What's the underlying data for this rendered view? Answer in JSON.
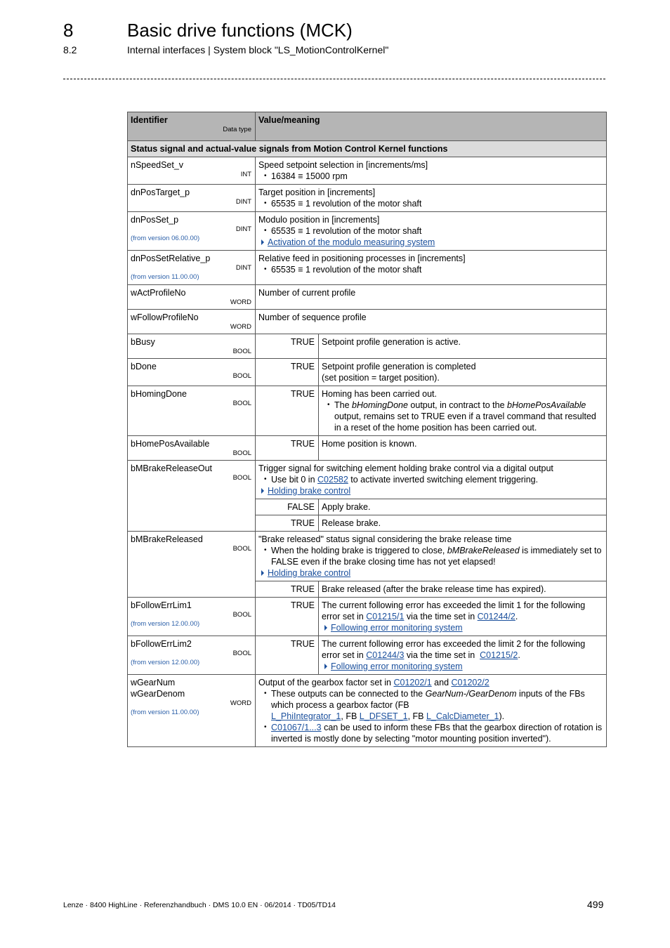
{
  "header": {
    "chapter_number": "8",
    "chapter_title": "Basic drive functions (MCK)",
    "section_number": "8.2",
    "section_title": "Internal interfaces | System block \"LS_MotionControlKernel\""
  },
  "table": {
    "col_identifier": "Identifier",
    "col_datatype": "Data type",
    "col_value": "Value/meaning",
    "group_title": "Status signal and actual-value signals from Motion Control Kernel functions",
    "rows": {
      "nSpeedSet_v": {
        "name": "nSpeedSet_v",
        "type": "INT",
        "desc": "Speed setpoint selection in [increments/ms]",
        "bullet": "16384 ≡ 15000 rpm"
      },
      "dnPosTarget_p": {
        "name": "dnPosTarget_p",
        "type": "DINT",
        "desc": "Target position in [increments]",
        "bullet": "65535 ≡ 1 revolution of the motor shaft"
      },
      "dnPosSet_p": {
        "name": "dnPosSet_p",
        "type": "DINT",
        "version": "(from version 06.00.00)",
        "desc": "Modulo position in [increments]",
        "bullet": "65535 ≡ 1 revolution of the motor shaft",
        "link": "Activation of the modulo measuring system"
      },
      "dnPosSetRelative_p": {
        "name": "dnPosSetRelative_p",
        "type": "DINT",
        "version": "(from version 11.00.00)",
        "desc": "Relative feed in positioning processes in [increments]",
        "bullet": "65535 ≡ 1 revolution of the motor shaft"
      },
      "wActProfileNo": {
        "name": "wActProfileNo",
        "type": "WORD",
        "desc": "Number of current profile"
      },
      "wFollowProfileNo": {
        "name": "wFollowProfileNo",
        "type": "WORD",
        "desc": "Number of sequence profile"
      },
      "bBusy": {
        "name": "bBusy",
        "type": "BOOL",
        "value": "TRUE",
        "desc": "Setpoint profile generation is active."
      },
      "bDone": {
        "name": "bDone",
        "type": "BOOL",
        "value": "TRUE",
        "desc": "Setpoint profile generation is completed",
        "desc2": "(set position = target position)."
      },
      "bHomingDone": {
        "name": "bHomingDone",
        "type": "BOOL",
        "value": "TRUE",
        "desc": "Homing has been carried out.",
        "bullet_pre": "The ",
        "bullet_em1": "bHomingDone",
        "bullet_mid": " output, in contract to the ",
        "bullet_em2": "bHomePosAvailable",
        "bullet_post": " output, remains set to TRUE even if a travel command that resulted in a reset of the home position has been carried out."
      },
      "bHomePosAvailable": {
        "name": "bHomePosAvailable",
        "type": "BOOL",
        "value": "TRUE",
        "desc": "Home position is known."
      },
      "bMBrakeReleaseOut": {
        "name": "bMBrakeReleaseOut",
        "type": "BOOL",
        "desc": "Trigger signal for switching element holding brake control via a digital output",
        "bullet_pre": "Use bit 0 in ",
        "bullet_link": "C02582",
        "bullet_post": " to activate inverted switching element triggering.",
        "link": "Holding brake control",
        "v1": "FALSE",
        "v1_desc": "Apply brake.",
        "v2": "TRUE",
        "v2_desc": "Release brake."
      },
      "bMBrakeReleased": {
        "name": "bMBrakeReleased",
        "type": "BOOL",
        "desc": "\"Brake released\" status signal considering the brake release time",
        "bullet_pre": "When the holding brake is triggered to close, ",
        "bullet_em": "bMBrakeReleased",
        "bullet_post": " is immediately set to FALSE even if the brake closing time has not yet elapsed!",
        "link": "Holding brake control",
        "v1": "TRUE",
        "v1_desc": "Brake released (after the brake release time has expired)."
      },
      "bFollowErrLim1": {
        "name": "bFollowErrLim1",
        "type": "BOOL",
        "version": "(from version 12.00.00)",
        "value": "TRUE",
        "desc_pre": "The current following error has exceeded the limit 1 for the following error set in ",
        "link1": "C01215/1",
        "desc_mid": " via the time set in ",
        "link2": "C01244/2",
        "desc_post": ".",
        "link": "Following error monitoring system"
      },
      "bFollowErrLim2": {
        "name": "bFollowErrLim2",
        "type": "BOOL",
        "version": "(from version 12.00.00)",
        "value": "TRUE",
        "desc_pre": "The current following error has exceeded the limit 2 for the following error set in ",
        "link1": "C01244/3",
        "desc_mid": " via the time set in  ",
        "link2": "C01215/2",
        "desc_post": ".",
        "link": "Following error monitoring system"
      },
      "wGear": {
        "name1": "wGearNum",
        "name2": "wGearDenom",
        "type": "WORD",
        "version": "(from version 11.00.00)",
        "desc_pre": "Output of the gearbox factor set in ",
        "link1": "C01202/1",
        "desc_mid": " and ",
        "link2": "C01202/2",
        "b1_pre": "These outputs can be connected to the ",
        "b1_em": "GearNum-/GearDenom",
        "b1_mid": " inputs of the FBs which process a gearbox factor (FB ",
        "b1_l1": "L_PhiIntegrator_1",
        "b1_m2": ", FB ",
        "b1_l2": "L_DFSET_1",
        "b1_m3": ", FB ",
        "b1_l3": "L_CalcDiameter_1",
        "b1_post": ").",
        "b2_link": "C01067/1...3",
        "b2_post": " can be used to inform these FBs that the gearbox direction of rotation is inverted is mostly done by selecting \"motor mounting position inverted\")."
      }
    }
  },
  "footer": {
    "doc_info": "Lenze · 8400 HighLine · Referenzhandbuch · DMS 10.0 EN · 06/2014 · TD05/TD14",
    "page_number": "499"
  },
  "colors": {
    "link": "#1a4f9c",
    "version": "#2b5fa8",
    "header_bg": "#b5b5b5",
    "group_bg": "#dcdcdc"
  }
}
